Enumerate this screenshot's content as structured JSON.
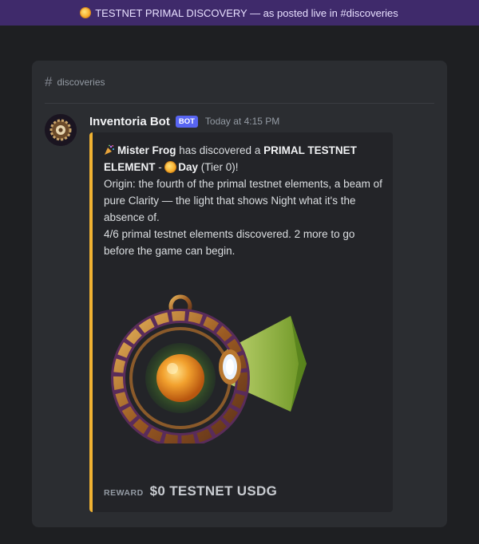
{
  "banner": {
    "text": "TESTNET PRIMAL DISCOVERY — as posted live in #discoveries",
    "icon": "sun-icon"
  },
  "channel": {
    "name": "discoveries",
    "icon": "hash-icon"
  },
  "message": {
    "author": "Inventoria Bot",
    "badge": "BOT",
    "timestamp": "Today at 4:15 PM",
    "accent_color": "#f0b232",
    "line1": {
      "discoverer": "Mister Frog",
      "middle": " has discovered a ",
      "kind": "PRIMAL TESTNET ELEMENT",
      "dash": " - ",
      "element": "Day",
      "tier": " (Tier 0)!"
    },
    "origin": "Origin: the fourth of the primal testnet elements, a beam of pure Clarity — the light that shows Night what it's the absence of.",
    "progress": "4/6 primal testnet elements discovered. 2 more to go before the game can begin.",
    "reward_label": "REWARD",
    "reward_value": "$0 TESTNET USDG"
  }
}
